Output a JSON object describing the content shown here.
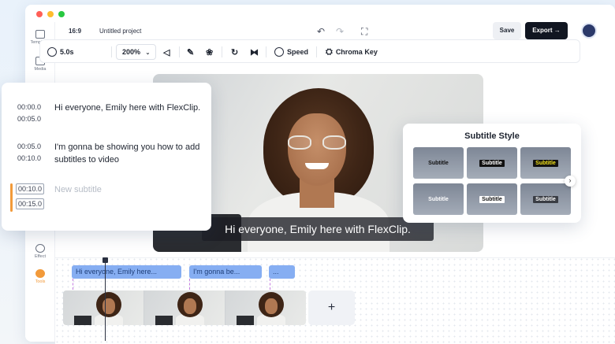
{
  "window": {
    "dot_colors": [
      "#ff5f57",
      "#febc2e",
      "#28c840"
    ]
  },
  "rail": {
    "items": [
      {
        "label": "Templates",
        "icon": "templates-icon"
      },
      {
        "label": "Media",
        "icon": "media-icon"
      },
      {
        "label": "Effect",
        "icon": "effect-icon"
      },
      {
        "label": "Tools",
        "icon": "tools-icon",
        "active": true
      }
    ]
  },
  "topbar": {
    "aspect_ratio": "16:9",
    "project_name": "Untitled project",
    "save_label": "Save",
    "export_label": "Export",
    "export_icon": "→"
  },
  "toolbar": {
    "duration": "5.0s",
    "zoom": "200%",
    "speed_label": "Speed",
    "chroma_label": "Chroma Key"
  },
  "preview": {
    "caption": "Hi everyone, Emily here with FlexClip."
  },
  "subtitle_list": {
    "entries": [
      {
        "start": "00:00.0",
        "end": "00:05.0",
        "text": "Hi everyone, Emily here with FlexClip."
      },
      {
        "start": "00:05.0",
        "end": "00:10.0",
        "text": "I'm gonna be showing you how to add subtitles to video"
      },
      {
        "start": "00:10.0",
        "end": "00:15.0",
        "placeholder": "New subtitle",
        "active": true
      }
    ]
  },
  "subtitle_style": {
    "title": "Subtitle Style",
    "presets": [
      {
        "label": "Subtitle",
        "text_color": "#111111",
        "bg": "transparent"
      },
      {
        "label": "Subtitle",
        "text_color": "#ffffff",
        "bg": "#111111"
      },
      {
        "label": "Subtitle",
        "text_color": "#f3e21a",
        "bg": "#111111"
      },
      {
        "label": "Subtitle",
        "text_color": "#ffffff",
        "bg": "transparent"
      },
      {
        "label": "Subtitle",
        "text_color": "#111111",
        "bg": "#ffffff"
      },
      {
        "label": "Subtitle",
        "text_color": "#ffffff",
        "bg": "#3a3d44"
      }
    ],
    "next_icon": "›"
  },
  "timeline": {
    "subtitle_clips": [
      "Hi everyone, Emily here...",
      "I'm gonna be...",
      "..."
    ],
    "add_label": "+"
  }
}
